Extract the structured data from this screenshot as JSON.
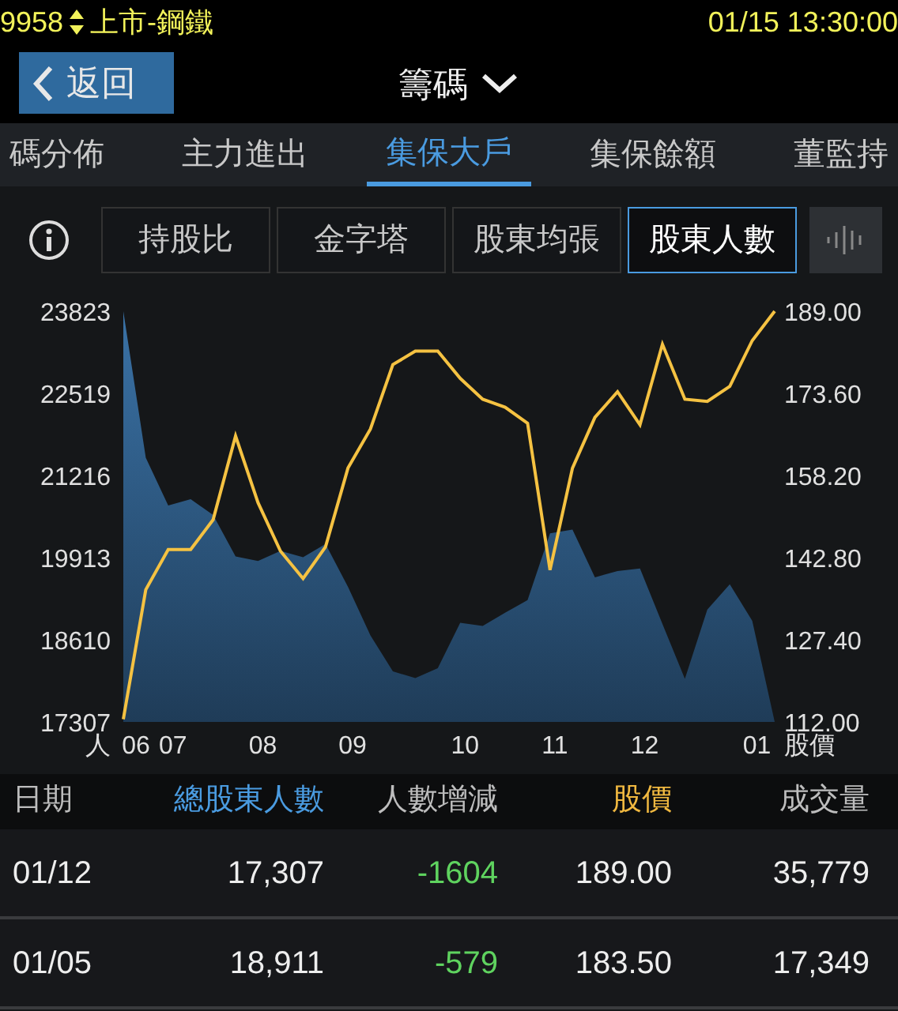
{
  "status_bar": {
    "code": "9958",
    "market": "上市-鋼鐵",
    "datetime": "01/15 13:30:00"
  },
  "header": {
    "back_button": "返回",
    "title": "籌碼"
  },
  "tabs": [
    {
      "label": "碼分佈",
      "selected": false
    },
    {
      "label": "主力進出",
      "selected": false
    },
    {
      "label": "集保大戶",
      "selected": true
    },
    {
      "label": "集保餘額",
      "selected": false
    },
    {
      "label": "董監持",
      "selected": false
    }
  ],
  "subtabs": [
    {
      "label": "持股比",
      "selected": false
    },
    {
      "label": "金字塔",
      "selected": false
    },
    {
      "label": "股東均張",
      "selected": false
    },
    {
      "label": "股東人數",
      "selected": true
    }
  ],
  "chart_data": {
    "type": "area",
    "ylabel": "人",
    "y2label": "股價",
    "categories": [
      "06",
      null,
      "07",
      null,
      null,
      null,
      "08",
      null,
      null,
      null,
      "09",
      null,
      null,
      null,
      null,
      "10",
      null,
      null,
      null,
      "11",
      null,
      null,
      null,
      "12",
      null,
      null,
      null,
      null,
      "01",
      null
    ],
    "ylim": [
      17307,
      23823
    ],
    "yticks": [
      {
        "value": 23823,
        "label": "23823"
      },
      {
        "value": 22519,
        "label": "22519"
      },
      {
        "value": 21216,
        "label": "21216"
      },
      {
        "value": 19913,
        "label": "19913"
      },
      {
        "value": 18610,
        "label": "18610"
      },
      {
        "value": 17307,
        "label": "17307"
      }
    ],
    "y2lim": [
      112,
      189
    ],
    "y2ticks": [
      {
        "value": 189,
        "label": "189.00"
      },
      {
        "value": 173.6,
        "label": "173.60"
      },
      {
        "value": 158.2,
        "label": "158.20"
      },
      {
        "value": 142.8,
        "label": "142.80"
      },
      {
        "value": 127.4,
        "label": "127.40"
      },
      {
        "value": 112,
        "label": "112.00"
      }
    ],
    "series": [
      {
        "color": "#3a72a6",
        "values": [
          23823,
          21500,
          20740,
          20840,
          20590,
          19930,
          19860,
          20020,
          19920,
          20130,
          19450,
          18680,
          18110,
          18000,
          18160,
          18880,
          18830,
          19040,
          19240,
          20300,
          20360,
          19600,
          19700,
          19740,
          18860,
          17990,
          19090,
          19490,
          18911,
          17307
        ]
      },
      {
        "type": "line",
        "axis": "y2",
        "color": "#f5c242",
        "values": [
          112.5,
          136.8,
          144.3,
          144.3,
          149.9,
          165.6,
          153.1,
          144.0,
          138.9,
          144.8,
          159.6,
          166.9,
          179.0,
          181.5,
          181.5,
          176.4,
          172.5,
          171.0,
          168.0,
          140.5,
          159.6,
          169.1,
          173.9,
          167.7,
          182.8,
          172.5,
          172.1,
          174.9,
          183.5,
          189.0
        ]
      }
    ]
  },
  "table": {
    "columns": [
      {
        "label": "日期",
        "color": "#bdbdbd"
      },
      {
        "label": "總股東人數",
        "color": "#4a9be0"
      },
      {
        "label": "人數增減",
        "color": "#bdbdbd"
      },
      {
        "label": "股價",
        "color": "#f0b840"
      },
      {
        "label": "成交量",
        "color": "#bdbdbd"
      }
    ],
    "rows": [
      {
        "date": "01/12",
        "holders": "17,307",
        "change": "-1604",
        "color": "#5fd35f",
        "price": "189.00",
        "volume": "35,779"
      },
      {
        "date": "01/05",
        "holders": "18,911",
        "change": "-579",
        "color": "#5fd35f",
        "price": "183.50",
        "volume": "17,349"
      }
    ]
  }
}
